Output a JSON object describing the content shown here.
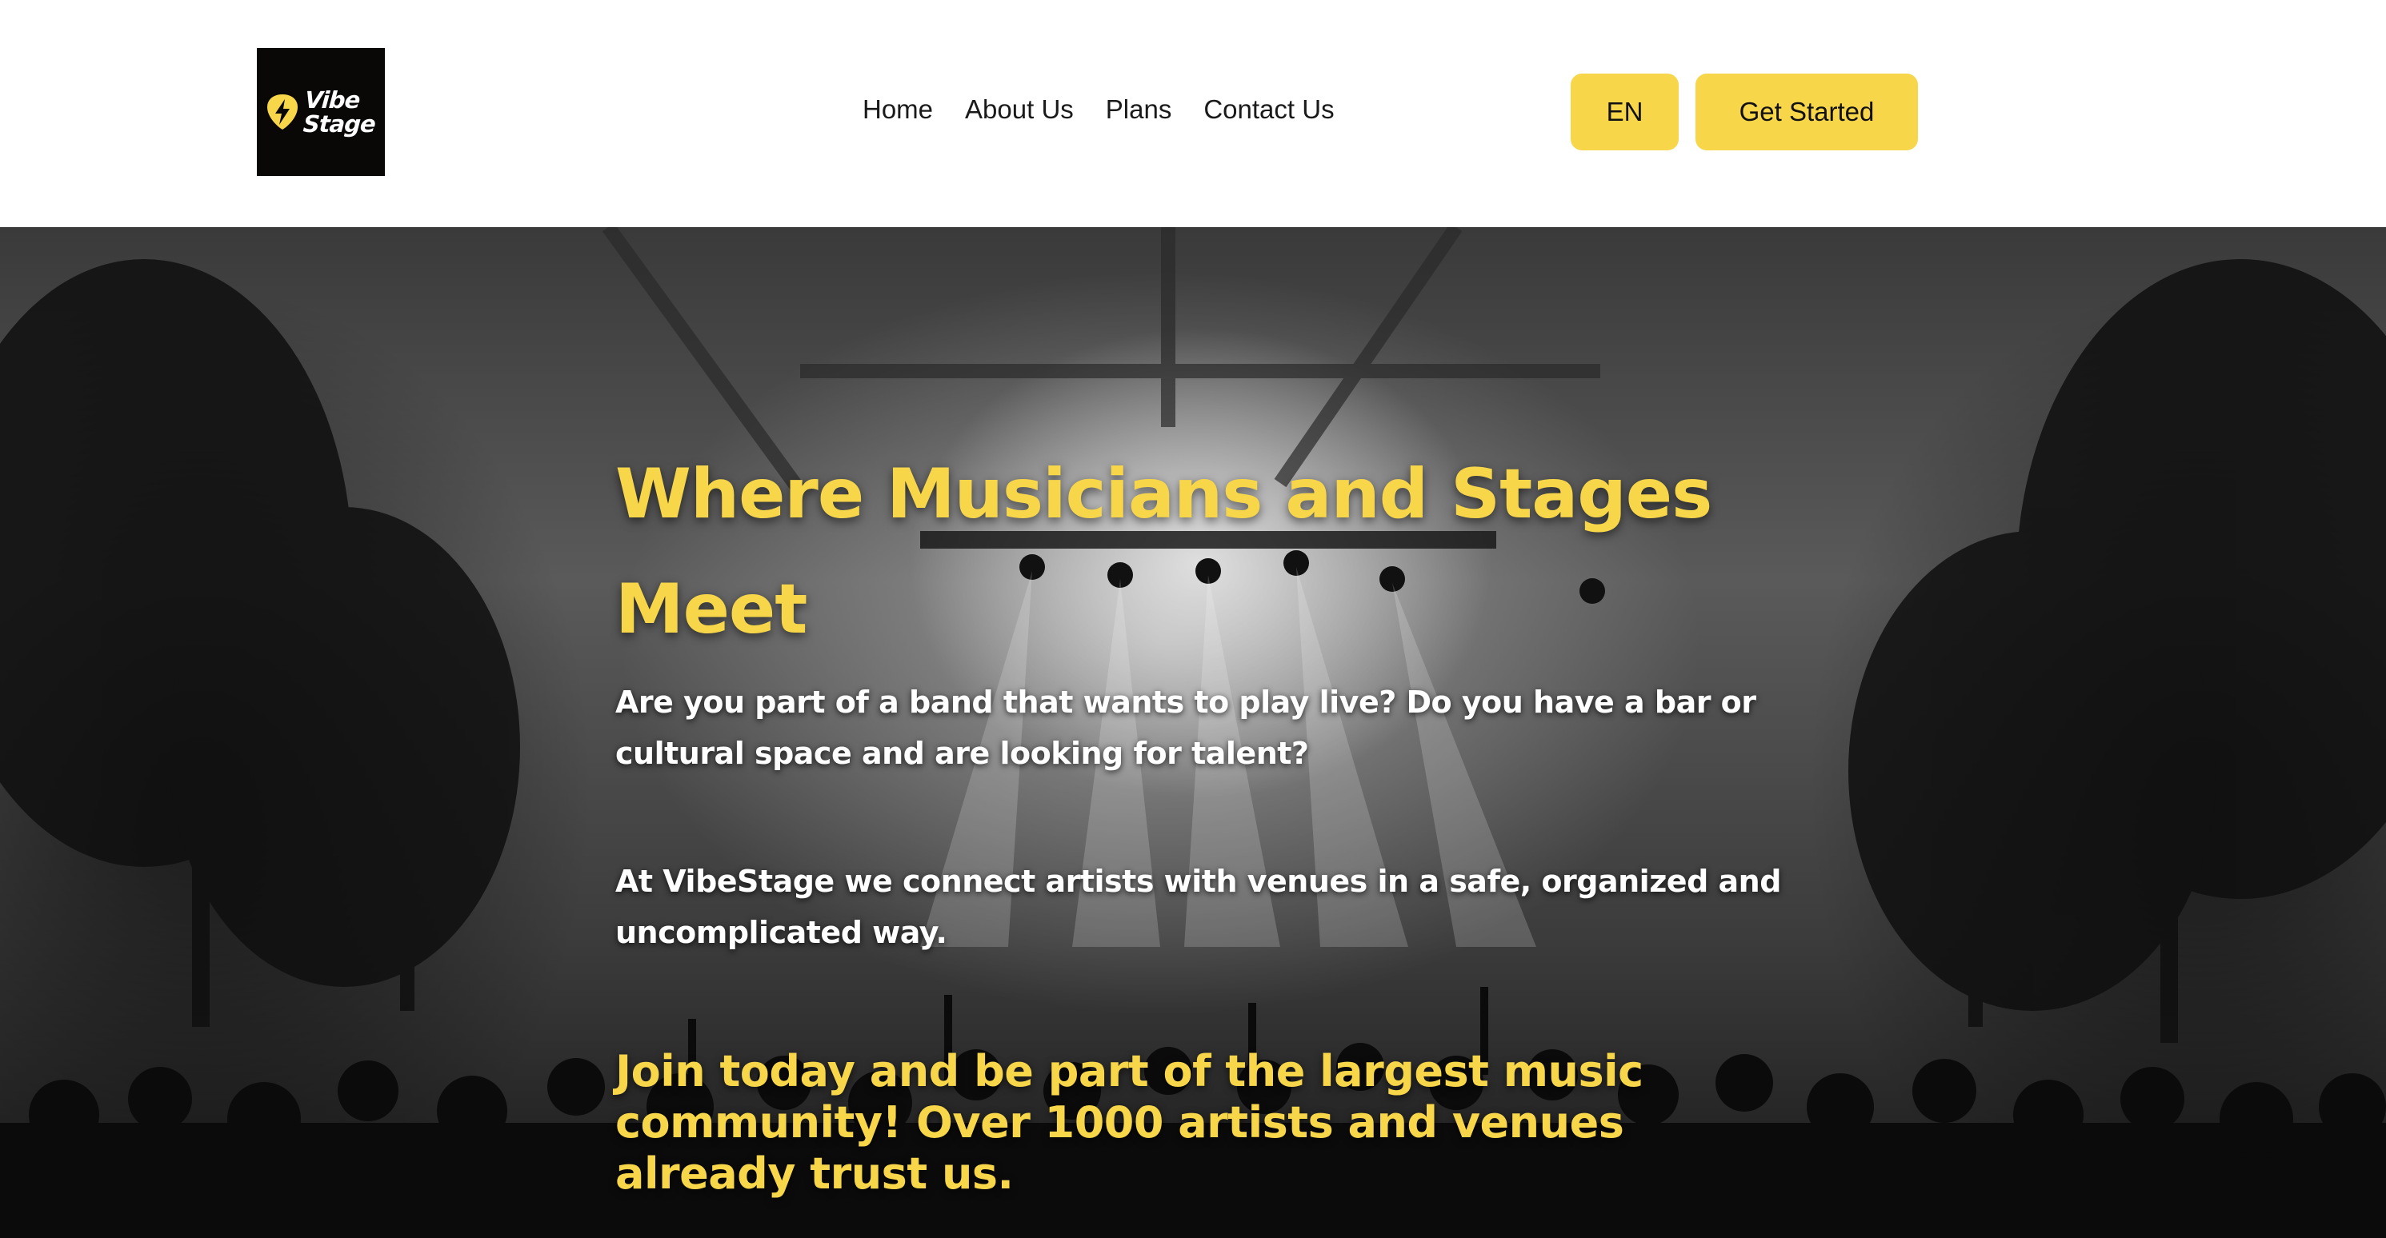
{
  "header": {
    "logo": {
      "icon": "lightning-pick-icon",
      "line1": "Vibe",
      "line2": "Stage",
      "background": "#0a0806"
    },
    "nav": [
      {
        "label": "Home"
      },
      {
        "label": "About Us"
      },
      {
        "label": "Plans"
      },
      {
        "label": "Contact Us"
      }
    ],
    "language_button": "EN",
    "cta_button": "Get Started"
  },
  "hero": {
    "title": "Where Musicians and Stages Meet",
    "paragraph1": "Are you part of a band that wants to play live? Do you have a bar or cultural space and are looking for talent?",
    "paragraph2": "At VibeStage we connect artists with venues in a safe, organized and uncomplicated way.",
    "cta_text": "Join today and be part of the largest music community! Over 1000 artists and venues already trust us.",
    "background_image": "black-and-white concert stage with crowd and trees"
  },
  "colors": {
    "accent": "#f7d64a",
    "text_dark": "#1a1a1a",
    "hero_text": "#ffffff"
  }
}
